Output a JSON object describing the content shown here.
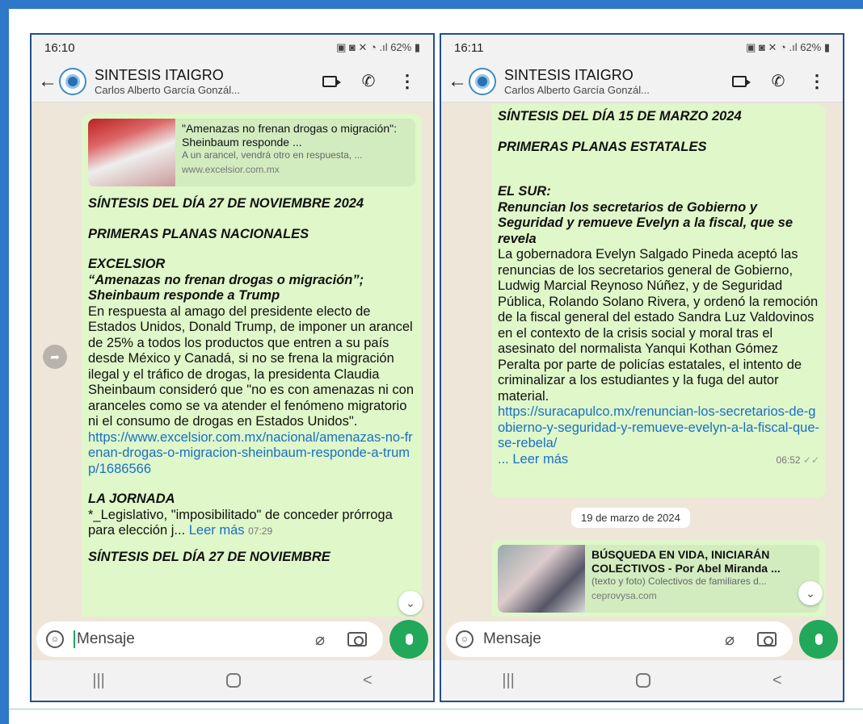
{
  "colors": {
    "frame": "#2f77c9",
    "bubble": "#dff7c9",
    "link": "#1a6fc6",
    "mic": "#21a85a"
  },
  "left": {
    "status": {
      "time": "16:10",
      "battery": "62%"
    },
    "header": {
      "title": "SINTESIS ITAIGRO",
      "subtitle": "Carlos Alberto García Gonzál..."
    },
    "preview": {
      "title": "\"Amenazas no frenan drogas o migración\": Sheinbaum responde ...",
      "desc": "A un arancel, vendrá otro en respuesta, ...",
      "url": "www.excelsior.com.mx"
    },
    "msg": {
      "heading1": "SÍNTESIS DEL DÍA 27 DE NOVIEMBRE 2024",
      "heading2": "PRIMERAS PLANAS NACIONALES",
      "paper": "EXCELSIOR",
      "headline": "“Amenazas no frenan drogas o migración”; Sheinbaum responde a Trump",
      "body": "En respuesta al amago del presidente electo de Estados Unidos, Donald Trump, de imponer un arancel de 25% a todos los productos que entren a su país desde México y Canadá, si no se frena la migración ilegal y el tráfico de drogas, la presidenta Claudia Sheinbaum consideró que \"no es con amenazas ni con aranceles como se va atender el fenómeno migratorio ni el consumo de drogas en Estados Unidos\".",
      "link": "https://www.excelsior.com.mx/nacional/amenazas-no-frenan-drogas-o-migracion-sheinbaum-responde-a-trump/1686566",
      "paper2": "LA JORNADA",
      "body2": "*_Legislativo, \"imposibilitado\" de conceder prórroga para elección j...",
      "readmore": "Leer más",
      "time": "07:29"
    },
    "next_heading": "SÍNTESIS DEL DÍA 27 DE NOVIEMBRE",
    "input_placeholder": "Mensaje"
  },
  "right": {
    "status": {
      "time": "16:11",
      "battery": "62%"
    },
    "header": {
      "title": "SINTESIS ITAIGRO",
      "subtitle": "Carlos Alberto García Gonzál..."
    },
    "msg": {
      "heading1": "SÍNTESIS DEL DÍA 15 DE MARZO 2024",
      "heading2": "PRIMERAS PLANAS ESTATALES",
      "paper": "EL SUR:",
      "headline": "Renuncian los secretarios de Gobierno y Seguridad y remueve Evelyn a la fiscal, que se revela",
      "body": "La gobernadora Evelyn Salgado Pineda aceptó las renuncias de los secretarios general de Gobierno, Ludwig Marcial Reynoso Núñez, y de Seguridad Pública, Rolando Solano Rivera, y ordenó la remoción de la fiscal general del estado Sandra Luz Valdovinos en el contexto de la crisis social y moral tras el asesinato del normalista Yanqui Kothan Gómez Peralta por parte de policías estatales, el intento de criminalizar a los estudiantes y la fuga del autor material.",
      "link": "https://suracapulco.mx/renuncian-los-secretarios-de-gobierno-y-seguridad-y-remueve-evelyn-a-la-fiscal-que-se-rebela/",
      "readmore": "... Leer más",
      "time": "06:52"
    },
    "date_chip": "19 de marzo de 2024",
    "preview": {
      "title": "BÚSQUEDA EN VIDA, INICIARÁN COLECTIVOS - Por Abel Miranda ...",
      "desc": "(texto y foto) Colectivos de familiares d...",
      "url": "ceprovysa.com"
    },
    "input_placeholder": "Mensaje"
  }
}
